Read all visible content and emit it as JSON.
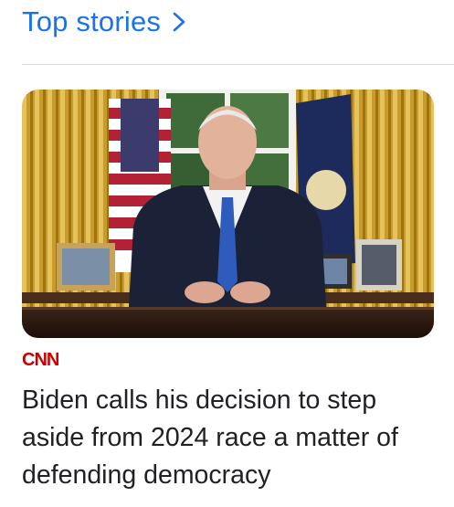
{
  "section": {
    "title": "Top stories",
    "chevron_icon": "chevron-right-icon"
  },
  "story": {
    "publisher": "CNN",
    "publisher_color": "#cc0000",
    "headline": "Biden calls his decision to step aside from 2024 race a matter of defending democracy",
    "image_alt": "Oval Office address photo"
  },
  "colors": {
    "link_blue": "#1a73e8",
    "divider": "#dadce0",
    "text": "#202124"
  }
}
